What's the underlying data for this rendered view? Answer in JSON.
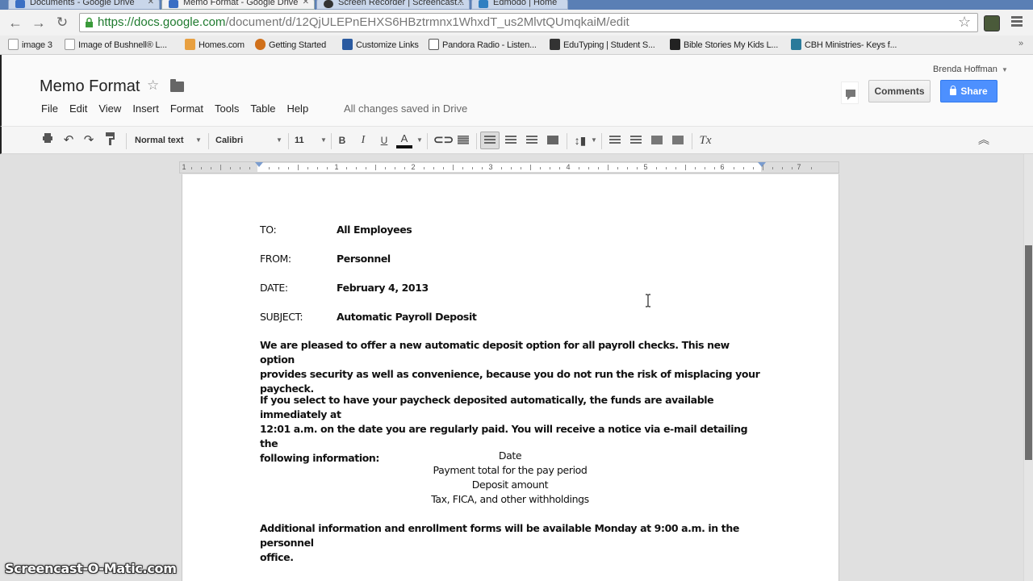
{
  "browser": {
    "tabs": [
      {
        "label": "Documents - Google Drive",
        "active": false
      },
      {
        "label": "Memo Format - Google Drive",
        "active": true
      },
      {
        "label": "Screen Recorder | Screencast...",
        "active": false
      },
      {
        "label": "Edmodo | Home",
        "active": false
      }
    ],
    "url_host": "https://docs.google.com",
    "url_path": "/document/d/12QjULEPnEHXS6HBztrmnx1WhxdT_us2MlvtQUmqkaiM/edit",
    "bookmarks": [
      {
        "label": "image 3",
        "icon": "page-icon"
      },
      {
        "label": "Image of Bushnell® L...",
        "icon": "page-icon"
      },
      {
        "label": "Homes.com",
        "icon": "homes-icon"
      },
      {
        "label": "Getting Started",
        "icon": "firefox-icon"
      },
      {
        "label": "Customize Links",
        "icon": "m-icon"
      },
      {
        "label": "Pandora Radio - Listen...",
        "icon": "pandora-icon"
      },
      {
        "label": "EduTyping | Student S...",
        "icon": "edutyping-icon"
      },
      {
        "label": "Bible Stories My Kids L...",
        "icon": "s-icon"
      },
      {
        "label": "CBH Ministries- Keys f...",
        "icon": "cbh-icon"
      }
    ],
    "bookmarks_overflow": "»"
  },
  "docs": {
    "title": "Memo Format",
    "menu": [
      "File",
      "Edit",
      "View",
      "Insert",
      "Format",
      "Tools",
      "Table",
      "Help"
    ],
    "save_status": "All changes saved in Drive",
    "user_name": "Brenda Hoffman",
    "comments_label": "Comments",
    "share_label": "Share",
    "share_color": "#4d90fe"
  },
  "toolbar": {
    "style": "Normal text",
    "font": "Calibri",
    "size": "11",
    "bold": "B",
    "italic": "I",
    "underline": "U",
    "text_color": "A",
    "clear_format": "Tx"
  },
  "ruler": {
    "numbers": [
      "1",
      "1",
      "2",
      "3",
      "4",
      "5",
      "6",
      "7"
    ]
  },
  "memo": {
    "header": [
      {
        "label": "TO:",
        "value": "All Employees"
      },
      {
        "label": "FROM:",
        "value": "Personnel"
      },
      {
        "label": "DATE:",
        "value": "February 4, 2013"
      },
      {
        "label": "SUBJECT:",
        "value": "Automatic Payroll Deposit"
      }
    ],
    "para1": [
      "We are pleased to offer a new automatic deposit option for all payroll checks. This new option",
      "provides security as well as convenience, because you do not run the risk of misplacing your",
      "paycheck."
    ],
    "para2": [
      "If you select to have your paycheck deposited automatically, the funds are available immediately at",
      "12:01 a.m. on the date you are regularly paid. You will receive a notice via e-mail detailing the",
      "following information:"
    ],
    "list": [
      "Date",
      "Payment total for the pay period",
      "Deposit amount",
      "Tax, FICA, and other withholdings"
    ],
    "para3": [
      "Additional information and enrollment forms will be available Monday at 9:00 a.m. in the personnel",
      "office."
    ]
  },
  "watermark": "Screencast-O-Matic.com"
}
